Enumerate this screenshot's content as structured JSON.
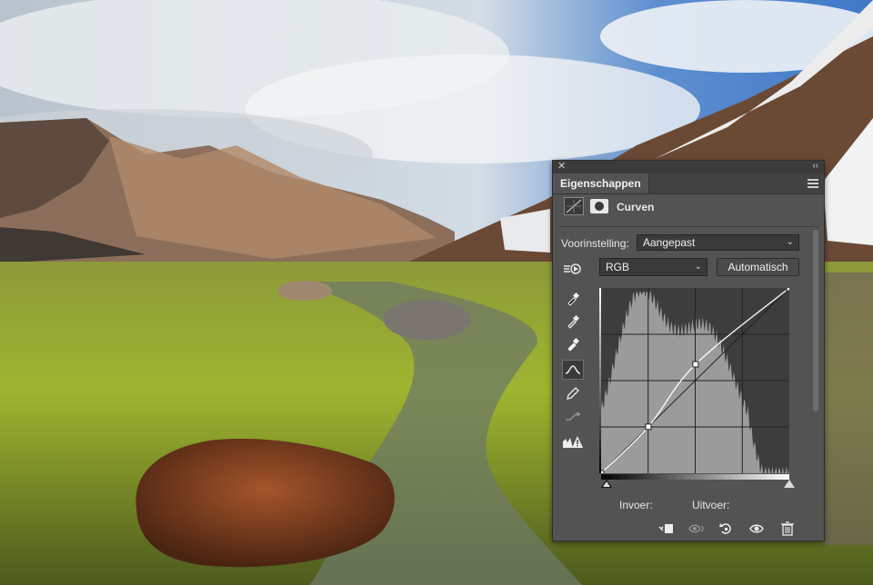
{
  "panel": {
    "tab_label": "Eigenschappen",
    "title": "Curven",
    "preset_label": "Voorinstelling:",
    "preset_value": "Aangepast",
    "channel_value": "RGB",
    "auto_button": "Automatisch",
    "input_label": "Invoer:",
    "output_label": "Uitvoer:"
  },
  "tools": [
    "target-adjust-icon",
    "eyedropper-black-icon",
    "eyedropper-gray-icon",
    "eyedropper-white-icon",
    "curve-points-icon",
    "pencil-icon",
    "smooth-icon",
    "clipping-warning-icon"
  ],
  "bottom_icons": [
    "clip-to-layer-icon",
    "view-previous-icon",
    "reset-icon",
    "visibility-icon",
    "trash-icon"
  ],
  "colors": {
    "panel_bg": "#535353",
    "graph_bg": "#3d3d3d",
    "histogram": "#9b9b9b",
    "curve": "#ffffff"
  },
  "chart_data": {
    "type": "area",
    "description_points": [
      [
        0,
        0
      ],
      [
        64,
        64
      ],
      [
        128,
        150
      ],
      [
        255,
        255
      ]
    ],
    "xlim": [
      0,
      255
    ],
    "ylim": [
      0,
      255
    ]
  }
}
